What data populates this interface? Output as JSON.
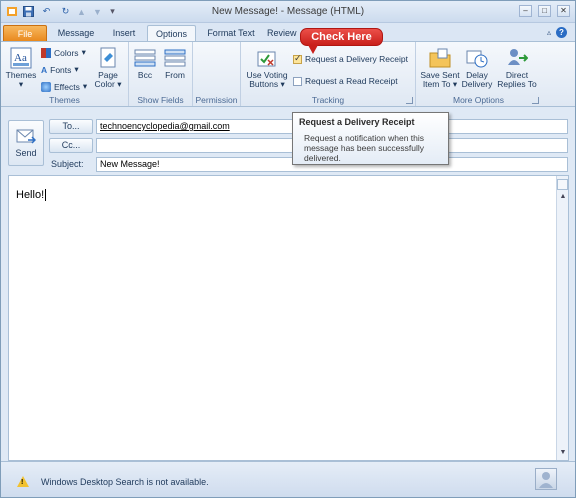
{
  "window": {
    "title": "New Message! - Message (HTML)",
    "min_symbol": "–",
    "max_symbol": "□",
    "close_symbol": "✕"
  },
  "tabs": [
    "File",
    "Message",
    "Insert",
    "Options",
    "Format Text",
    "Review"
  ],
  "ribbon": {
    "themes": {
      "themes_label": "Themes",
      "colors_label": "Colors",
      "fonts_label": "Fonts",
      "effects_label": "Effects",
      "page_color_label": "Page Color",
      "group_label": "Themes"
    },
    "show_fields": {
      "bcc_label": "Bcc",
      "from_label": "From",
      "group_label": "Show Fields"
    },
    "permission": {
      "group_label": "Permission"
    },
    "tracking": {
      "voting_label": "Use Voting Buttons",
      "delivery_receipt_label": "Request a Delivery Receipt",
      "delivery_receipt_checked": true,
      "read_receipt_label": "Request a Read Receipt",
      "read_receipt_checked": false,
      "group_label": "Tracking"
    },
    "more_options": {
      "save_sent_label": "Save Sent Item To",
      "delay_label": "Delay Delivery",
      "direct_label": "Direct Replies To",
      "group_label": "More Options"
    }
  },
  "callout": {
    "text": "Check Here"
  },
  "tooltip": {
    "title": "Request a Delivery Receipt",
    "body": "Request a notification when this message has been successfully delivered."
  },
  "compose": {
    "send_label": "Send",
    "to_label": "To...",
    "to_value": "technoencyclopedia@gmail.com",
    "cc_label": "Cc...",
    "cc_value": "",
    "subject_label": "Subject:",
    "subject_value": "New Message!",
    "body_text": "Hello!"
  },
  "status": {
    "text": "Windows Desktop Search is not available."
  },
  "colors": {
    "file_tab": "#e8861a",
    "callout": "#c9201b",
    "accent": "#1e395b"
  }
}
